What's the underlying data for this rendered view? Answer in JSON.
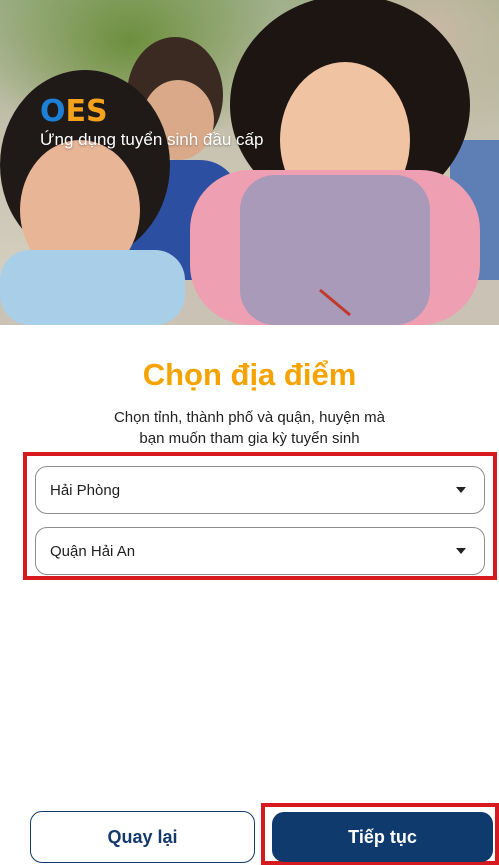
{
  "hero": {
    "image": "students-in-classroom-photo",
    "logo_o": "O",
    "logo_rest": "ES",
    "tagline": "Ứng dụng tuyển sinh đầu cấp"
  },
  "page": {
    "title": "Chọn địa điểm",
    "subtitle_line1": "Chọn tỉnh, thành phố và quận, huyện mà",
    "subtitle_line2": "bạn muốn tham gia kỳ tuyển sinh"
  },
  "selects": {
    "province": {
      "value": "Hải Phòng"
    },
    "district": {
      "value": "Quận Hải An"
    }
  },
  "buttons": {
    "back": "Quay lại",
    "next": "Tiếp tục"
  },
  "colors": {
    "title": "#f5a300",
    "primary": "#0e3a6d",
    "highlight": "#d71920"
  }
}
